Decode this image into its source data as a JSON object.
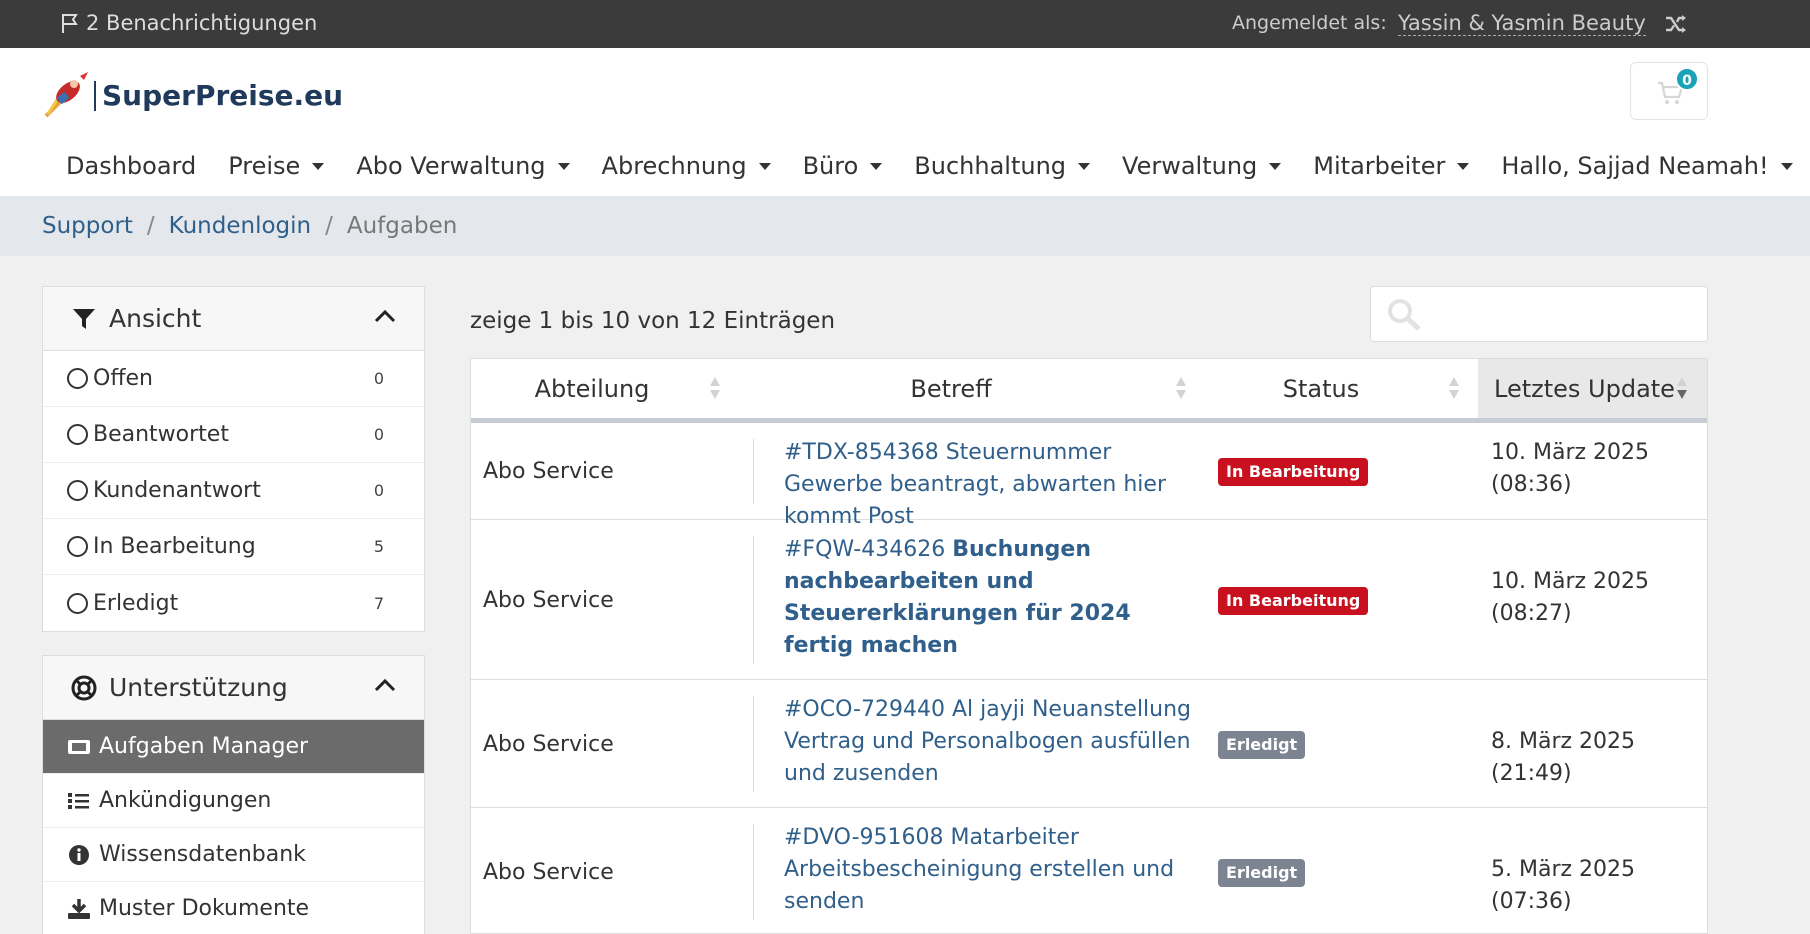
{
  "topbar": {
    "notifications": "2 Benachrichtigungen",
    "login_label": "Angemeldet als:",
    "login_user": "Yassin & Yasmin Beauty"
  },
  "logo": {
    "text": "SuperPreise.eu"
  },
  "cart": {
    "count": "0"
  },
  "nav": [
    {
      "label": "Dashboard",
      "dropdown": false
    },
    {
      "label": "Preise",
      "dropdown": true
    },
    {
      "label": "Abo Verwaltung",
      "dropdown": true
    },
    {
      "label": "Abrechnung",
      "dropdown": true
    },
    {
      "label": "Büro",
      "dropdown": true
    },
    {
      "label": "Buchhaltung",
      "dropdown": true
    },
    {
      "label": "Verwaltung",
      "dropdown": true
    },
    {
      "label": "Mitarbeiter",
      "dropdown": true
    },
    {
      "label": "Hallo, Sajjad Neamah!",
      "dropdown": true
    }
  ],
  "breadcrumb": [
    "Support",
    "Kundenlogin",
    "Aufgaben"
  ],
  "sidebar": {
    "view_title": "Ansicht",
    "filters": [
      {
        "label": "Offen",
        "count": "0"
      },
      {
        "label": "Beantwortet",
        "count": "0"
      },
      {
        "label": "Kundenantwort",
        "count": "0"
      },
      {
        "label": "In Bearbeitung",
        "count": "5"
      },
      {
        "label": "Erledigt",
        "count": "7"
      }
    ],
    "support_title": "Unterstützung",
    "menu": [
      {
        "label": "Aufgaben Manager",
        "icon": "ticket-icon",
        "active": true
      },
      {
        "label": "Ankündigungen",
        "icon": "list-icon",
        "active": false
      },
      {
        "label": "Wissensdatenbank",
        "icon": "info-icon",
        "active": false
      },
      {
        "label": "Muster Dokumente",
        "icon": "download-icon",
        "active": false
      }
    ]
  },
  "main": {
    "info": "zeige 1 bis 10 von 12 Einträgen",
    "search_placeholder": "",
    "columns": [
      "Abteilung",
      "Betreff",
      "Status",
      "Letztes Update"
    ],
    "rows": [
      {
        "dept": "Abo Service",
        "id": "#TDX-854368",
        "subject": "Steuernummer Gewerbe beantragt, abwarten hier kommt Post",
        "bold": false,
        "status": "In Bearbeitung",
        "status_color": "#c8101e",
        "update_line1": "10. März 2025",
        "update_line2": "(08:36)"
      },
      {
        "dept": "Abo Service",
        "id": "#FQW-434626",
        "subject": "Buchungen nachbearbeiten und Steuererklärungen für 2024 fertig machen",
        "bold": true,
        "status": "In Bearbeitung",
        "status_color": "#c8101e",
        "update_line1": "10. März 2025",
        "update_line2": "(08:27)"
      },
      {
        "dept": "Abo Service",
        "id": "#OCO-729440",
        "subject": "Al jayji Neuanstellung Vertrag und Personalbogen ausfüllen und zusenden",
        "bold": false,
        "status": "Erledigt",
        "status_color": "#7b8490",
        "update_line1": "8. März 2025 (21:49)",
        "update_line2": ""
      },
      {
        "dept": "Abo Service",
        "id": "#DVO-951608",
        "subject": "Matarbeiter Arbeitsbescheinigung erstellen und senden",
        "bold": false,
        "status": "Erledigt",
        "status_color": "#7b8490",
        "update_line1": "5. März 2025 (07:36)",
        "update_line2": ""
      }
    ]
  }
}
